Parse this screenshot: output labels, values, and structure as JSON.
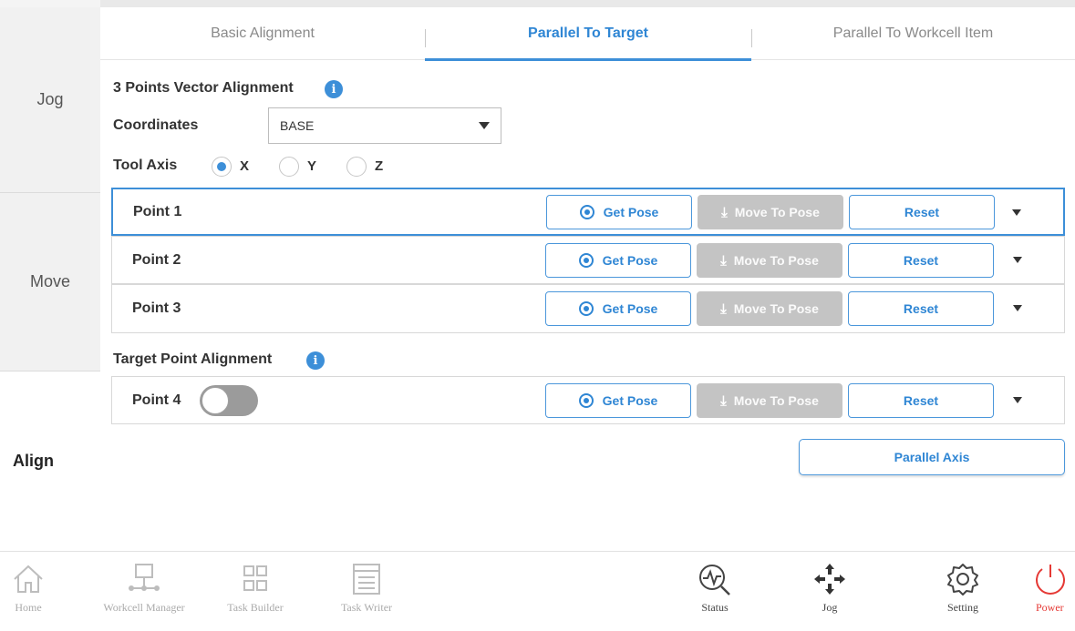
{
  "tabs": [
    {
      "label": "Basic Alignment",
      "active": false
    },
    {
      "label": "Parallel To Target",
      "active": true
    },
    {
      "label": "Parallel To Workcell Item",
      "active": false
    }
  ],
  "sidebar": {
    "items": [
      {
        "label": "Jog",
        "active": false
      },
      {
        "label": "Move",
        "active": false
      },
      {
        "label": "Align",
        "active": true
      }
    ]
  },
  "vector_section": {
    "title": "3 Points Vector Alignment",
    "coordinates_label": "Coordinates",
    "coordinates_value": "BASE",
    "tool_axis_label": "Tool Axis",
    "axes": [
      {
        "label": "X",
        "checked": true
      },
      {
        "label": "Y",
        "checked": false
      },
      {
        "label": "Z",
        "checked": false
      }
    ]
  },
  "points": [
    {
      "name": "Point 1",
      "selected": true
    },
    {
      "name": "Point 2",
      "selected": false
    },
    {
      "name": "Point 3",
      "selected": false
    }
  ],
  "target_section": {
    "title": "Target Point Alignment",
    "point_name": "Point 4",
    "toggle_on": false
  },
  "buttons": {
    "get_pose": "Get Pose",
    "move_to_pose": "Move To Pose",
    "reset": "Reset",
    "parallel_axis": "Parallel Axis"
  },
  "bottom_nav": [
    {
      "label": "Home",
      "icon": "home-icon"
    },
    {
      "label": "Workcell Manager",
      "icon": "workcell-manager-icon"
    },
    {
      "label": "Task Builder",
      "icon": "task-builder-icon"
    },
    {
      "label": "Task Writer",
      "icon": "task-writer-icon"
    },
    {
      "label": "Status",
      "icon": "status-icon"
    },
    {
      "label": "Jog",
      "icon": "jog-icon"
    },
    {
      "label": "Setting",
      "icon": "gear-icon"
    },
    {
      "label": "Power",
      "icon": "power-icon"
    }
  ],
  "colors": {
    "accent": "#3d8fd8",
    "disabled": "#c4c4c4",
    "power": "#e53935"
  }
}
